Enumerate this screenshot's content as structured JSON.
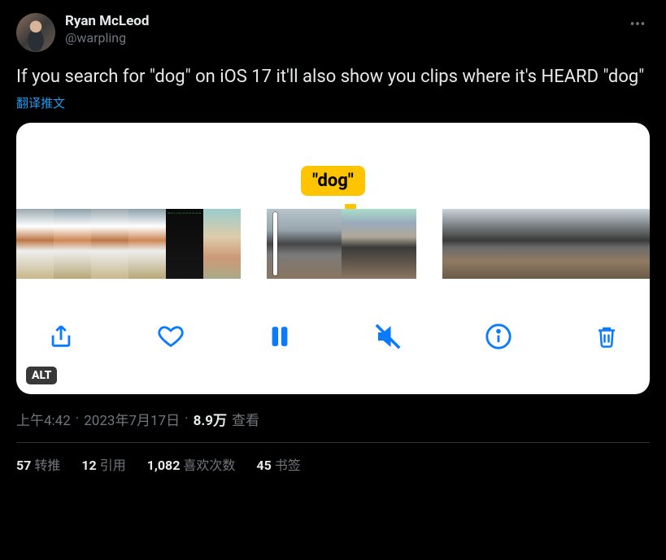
{
  "author": {
    "display_name": "Ryan McLeod",
    "handle": "@warpling"
  },
  "tweet_text": "If you search for \"dog\" on iOS 17 it'll also show you clips where it's HEARD \"dog\"",
  "translate_label": "翻译推文",
  "media": {
    "tooltip_text": "\"dog\"",
    "alt_badge": "ALT",
    "controls": {
      "share": "share-icon",
      "like": "heart-icon",
      "pause": "pause-icon",
      "mute": "speaker-muted-icon",
      "info": "info-icon",
      "trash": "trash-icon"
    }
  },
  "meta": {
    "time": "上午4:42",
    "dot": "·",
    "date": "2023年7月17日",
    "views_number": "8.9万",
    "views_label": "查看"
  },
  "stats": {
    "retweets": {
      "num": "57",
      "label": "转推"
    },
    "quotes": {
      "num": "12",
      "label": "引用"
    },
    "likes": {
      "num": "1,082",
      "label": "喜欢次数"
    },
    "bookmarks": {
      "num": "45",
      "label": "书签"
    }
  }
}
